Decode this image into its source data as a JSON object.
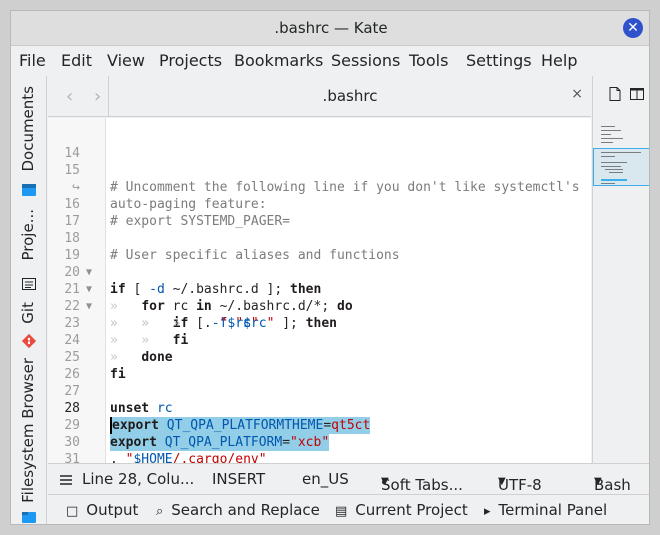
{
  "window": {
    "title": ".bashrc — Kate"
  },
  "menu": [
    "File",
    "Edit",
    "View",
    "Projects",
    "Bookmarks",
    "Sessions",
    "Tools",
    "Settings",
    "Help"
  ],
  "left_sidebar": {
    "tabs": [
      "Documents",
      "Proje...",
      "Git",
      "Filesystem Browser"
    ]
  },
  "tab": {
    "title": ".bashrc",
    "close": "×"
  },
  "nav": {
    "back": "‹",
    "forward": "›"
  },
  "editor": {
    "current_line": "28",
    "lines": [
      {
        "n": "14",
        "text": ""
      },
      {
        "n": "15",
        "text": "# Uncomment the following line if you don't like systemctl's"
      },
      {
        "n": "↪",
        "text": "auto-paging feature:"
      },
      {
        "n": "16",
        "text": "# export SYSTEMD_PAGER="
      },
      {
        "n": "17",
        "text": ""
      },
      {
        "n": "18",
        "text": "# User specific aliases and functions"
      },
      {
        "n": "19",
        "text": "if [ -d ~/.bashrc.d ]; then"
      },
      {
        "n": "20",
        "text": "for rc in ~/.bashrc.d/*; do"
      },
      {
        "n": "21",
        "text": "if [ -f \"$rc\" ]; then"
      },
      {
        "n": "22",
        "text": ". \"$rc\""
      },
      {
        "n": "23",
        "text": "fi"
      },
      {
        "n": "24",
        "text": "done"
      },
      {
        "n": "25",
        "text": "fi"
      },
      {
        "n": "26",
        "text": ""
      },
      {
        "n": "27",
        "text": "unset rc"
      },
      {
        "n": "28",
        "text": "export QT_QPA_PLATFORMTHEME=qt5ct"
      },
      {
        "n": "29",
        "text": "export QT_QPA_PLATFORM=\"xcb\""
      },
      {
        "n": "30",
        "text": ". \"$HOME/.cargo/env\""
      },
      {
        "n": "31",
        "text": ""
      }
    ]
  },
  "status": {
    "position": "Line 28, Colu...",
    "mode": "INSERT",
    "dictionary": "en_US",
    "indent": "Soft Tabs...",
    "encoding": "UTF-8",
    "syntax": "Bash"
  },
  "bottom_panels": [
    "Output",
    "Search and Replace",
    "Current Project",
    "Terminal Panel"
  ],
  "colors": {
    "selection": "#93cee9",
    "accent": "#2f52cc",
    "comment": "#7a7c7d",
    "string": "#bf0303",
    "variable": "#0057ae"
  }
}
